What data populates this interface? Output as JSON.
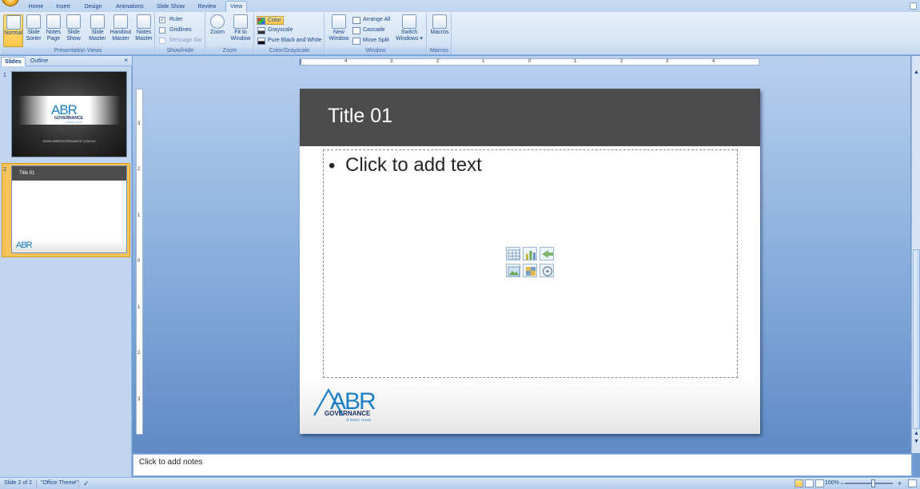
{
  "ribbon": {
    "tabs": [
      "Home",
      "Insert",
      "Design",
      "Animations",
      "Slide Show",
      "Review",
      "View"
    ],
    "active_tab": "View",
    "groups": {
      "presentation_views": {
        "label": "Presentation Views",
        "buttons": [
          {
            "line1": "Normal",
            "line2": ""
          },
          {
            "line1": "Slide",
            "line2": "Sorter"
          },
          {
            "line1": "Notes",
            "line2": "Page"
          },
          {
            "line1": "Slide",
            "line2": "Show"
          },
          {
            "line1": "Slide",
            "line2": "Master"
          },
          {
            "line1": "Handout",
            "line2": "Master"
          },
          {
            "line1": "Notes",
            "line2": "Master"
          }
        ]
      },
      "show_hide": {
        "label": "Show/Hide",
        "ruler": {
          "label": "Ruler",
          "checked": true
        },
        "gridlines": {
          "label": "Gridlines",
          "checked": false
        },
        "message_bar": {
          "label": "Message Bar",
          "checked": false
        }
      },
      "zoom": {
        "label": "Zoom",
        "zoom_btn": {
          "line1": "Zoom",
          "line2": ""
        },
        "fit_btn": {
          "line1": "Fit to",
          "line2": "Window"
        }
      },
      "color": {
        "label": "Color/Grayscale",
        "color": "Color",
        "grayscale": "Grayscale",
        "pure": "Pure Black and White"
      },
      "window": {
        "label": "Window",
        "new_window": {
          "line1": "New",
          "line2": "Window"
        },
        "arrange_all": "Arrange All",
        "cascade": "Cascade",
        "move_split": "Move Split",
        "switch_windows": {
          "line1": "Switch",
          "line2": "Windows ▾"
        }
      },
      "macros": {
        "label": "Macros",
        "macros_btn": "Macros"
      }
    }
  },
  "left_pane": {
    "tabs": [
      "Slides",
      "Outline"
    ],
    "close": "×",
    "slides": [
      {
        "number": "1",
        "url_text": "WWW.ABRGOVERNANCE.COM.AU"
      },
      {
        "number": "2",
        "title": "Title 01"
      }
    ]
  },
  "logo": {
    "letters": "ABR",
    "word": "GOVERNANCE",
    "tagline": "A better result"
  },
  "ruler": {
    "h_labels": [
      "4",
      "3",
      "2",
      "1",
      "0",
      "1",
      "2",
      "3",
      "4"
    ],
    "v_labels": [
      "3",
      "2",
      "1",
      "0",
      "1",
      "2",
      "3"
    ]
  },
  "slide": {
    "title": "Title 01",
    "bullet": "•",
    "body_text": "Click to add text"
  },
  "notes": {
    "placeholder": "Click to add notes"
  },
  "status": {
    "slide_info": "Slide 2 of 2",
    "theme": "\"Office Theme\"",
    "zoom_level": "100%",
    "zoom_minus": "−",
    "zoom_plus": "+"
  },
  "colors": {
    "accent": "#15428b",
    "ribbon_bg": "#dbe7f7",
    "title_bar": "#4c4c4c",
    "logo_blue": "#1d7fc4",
    "logo_navy": "#1a2e66"
  }
}
